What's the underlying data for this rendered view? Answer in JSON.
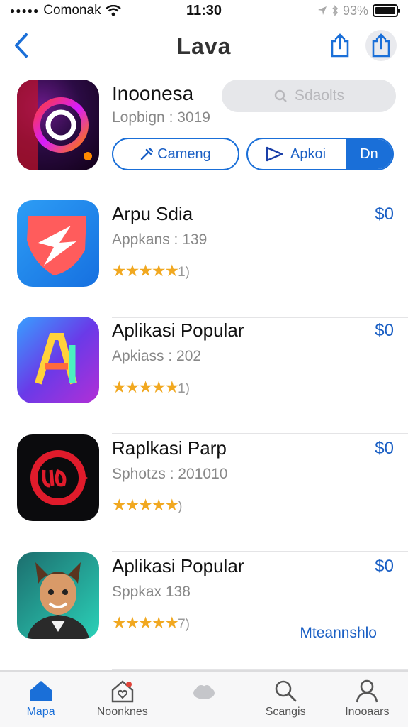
{
  "status_bar": {
    "carrier": "Comonak",
    "time": "11:30",
    "battery": "93%"
  },
  "nav": {
    "title": "Lava"
  },
  "featured": {
    "name": "Inoonesa",
    "subtitle": "Lopbign : 3019",
    "search_placeholder": "Sdaolts",
    "gaming_label": "Cameng",
    "apk_label": "Apkoi",
    "apk_toggle": "Dn"
  },
  "apps": [
    {
      "name": "Arpu Sdia",
      "subtitle": "Appkans : 139",
      "rating_value": 5,
      "rating_suffix": "1)",
      "price": "$0"
    },
    {
      "name": "Aplikasi Popular",
      "subtitle": "Apkiass : 202",
      "rating_value": 5,
      "rating_suffix": "1)",
      "price": "$0"
    },
    {
      "name": "Raplkasi Parp",
      "subtitle": "Sphotzs : 201010",
      "rating_value": 5,
      "rating_suffix": ")",
      "price": "$0"
    },
    {
      "name": "Aplikasi Popular",
      "subtitle": "Sppkax 138",
      "rating_value": 5,
      "rating_suffix": "7)",
      "price": "$0",
      "link": "Mteannshlo"
    }
  ],
  "tabs": [
    {
      "label": "Mapa",
      "icon": "home-icon",
      "active": true
    },
    {
      "label": "Noonknes",
      "icon": "house-heart-icon",
      "active": false
    },
    {
      "label": "",
      "icon": "cloud-icon",
      "active": false
    },
    {
      "label": "Scangis",
      "icon": "search-icon",
      "active": false
    },
    {
      "label": "Inooaars",
      "icon": "person-icon",
      "active": false
    }
  ],
  "colors": {
    "accent": "#1a6fd8",
    "star": "#f1a820",
    "price": "#1a5fc4"
  }
}
